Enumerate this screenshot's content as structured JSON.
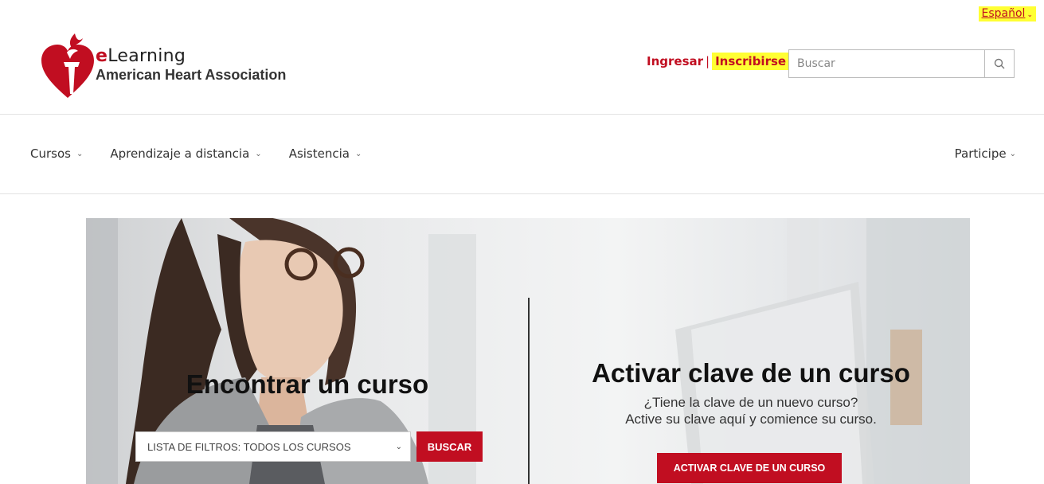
{
  "language": {
    "label": "Español"
  },
  "brand": {
    "e_letter": "e",
    "name_rest": "Learning",
    "org": "American Heart Association"
  },
  "auth": {
    "login": "Ingresar",
    "separator": "|",
    "register": "Inscribirse"
  },
  "search": {
    "placeholder": "Buscar"
  },
  "nav": {
    "items": [
      {
        "label": "Cursos"
      },
      {
        "label": "Aprendizaje a distancia"
      },
      {
        "label": "Asistencia"
      }
    ],
    "right": {
      "label": "Participe"
    }
  },
  "hero": {
    "find": {
      "title": "Encontrar un curso",
      "filter_selected": "LISTA DE FILTROS: TODOS LOS CURSOS",
      "button": "BUSCAR"
    },
    "activate": {
      "title": "Activar clave de un curso",
      "line1": "¿Tiene la clave de un nuevo curso?",
      "line2": "Active su clave aquí y comience su curso.",
      "button": "ACTIVAR CLAVE DE UN CURSO"
    }
  },
  "colors": {
    "accent": "#c10e21",
    "highlight": "#ffff33"
  }
}
